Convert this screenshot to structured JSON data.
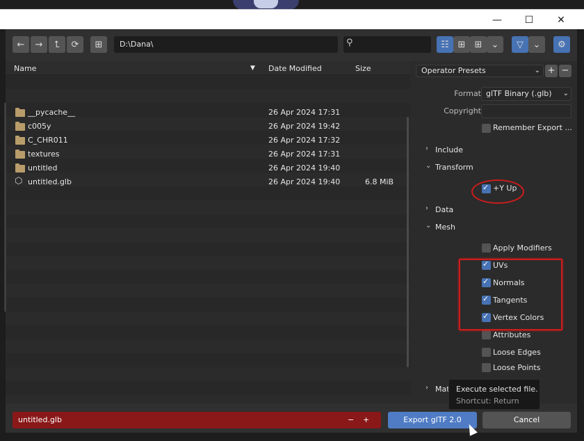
{
  "window": {
    "minimize_glyph": "—",
    "maximize_glyph": "☐",
    "close_glyph": "✕"
  },
  "toolbar": {
    "back_icon": "←",
    "forward_icon": "→",
    "parent_icon": "⮤",
    "refresh_icon": "⟳",
    "new_folder_icon": "⊞",
    "path": "D:\\Dana\\",
    "search_icon": "⚲",
    "view_list_icon": "☷",
    "view_thumb_small_icon": "⊞",
    "view_thumb_large_icon": "⊞",
    "view_dropdown_icon": "⌄",
    "filter_icon": "▽",
    "filter_dropdown_icon": "⌄",
    "settings_icon": "⚙",
    "accent": "#4772b3"
  },
  "columns": {
    "name": "Name",
    "sort_indicator": "▼",
    "date": "Date Modified",
    "size": "Size"
  },
  "files": [
    {
      "name": "__pycache__",
      "date": "26 Apr 2024 17:31",
      "size": "",
      "type": "folder"
    },
    {
      "name": "c005y",
      "date": "26 Apr 2024 19:42",
      "size": "",
      "type": "folder"
    },
    {
      "name": "C_CHR011",
      "date": "26 Apr 2024 17:32",
      "size": "",
      "type": "folder"
    },
    {
      "name": "textures",
      "date": "26 Apr 2024 17:31",
      "size": "",
      "type": "folder"
    },
    {
      "name": "untitled",
      "date": "26 Apr 2024 19:40",
      "size": "",
      "type": "folder"
    },
    {
      "name": "untitled.glb",
      "date": "26 Apr 2024 19:40",
      "size": "6.8 MiB",
      "type": "file"
    }
  ],
  "side": {
    "presets_label": "Operator Presets",
    "presets_add": "+",
    "presets_remove": "−",
    "format_label": "Format",
    "format_value": "glTF Binary (.glb)",
    "copyright_label": "Copyright",
    "copyright_value": "",
    "remember_label": "Remember Export ...",
    "include_label": "Include",
    "transform_label": "Transform",
    "yup_label": "+Y Up",
    "data_label": "Data",
    "mesh_label": "Mesh",
    "apply_modifiers_label": "Apply Modifiers",
    "uvs_label": "UVs",
    "normals_label": "Normals",
    "tangents_label": "Tangents",
    "vertex_colors_label": "Vertex Colors",
    "attributes_label": "Attributes",
    "loose_edges_label": "Loose Edges",
    "loose_points_label": "Loose Points",
    "material_label": "Mat",
    "collapsed_chevron": "›",
    "expanded_chevron": "⌄"
  },
  "bottom": {
    "filename": "untitled.glb",
    "dec": "−",
    "inc": "+",
    "export_label": "Export glTF 2.0",
    "cancel_label": "Cancel",
    "filename_color": "#8a1818"
  },
  "tooltip": {
    "title": "Execute selected file.",
    "shortcut": "Shortcut: Return"
  }
}
